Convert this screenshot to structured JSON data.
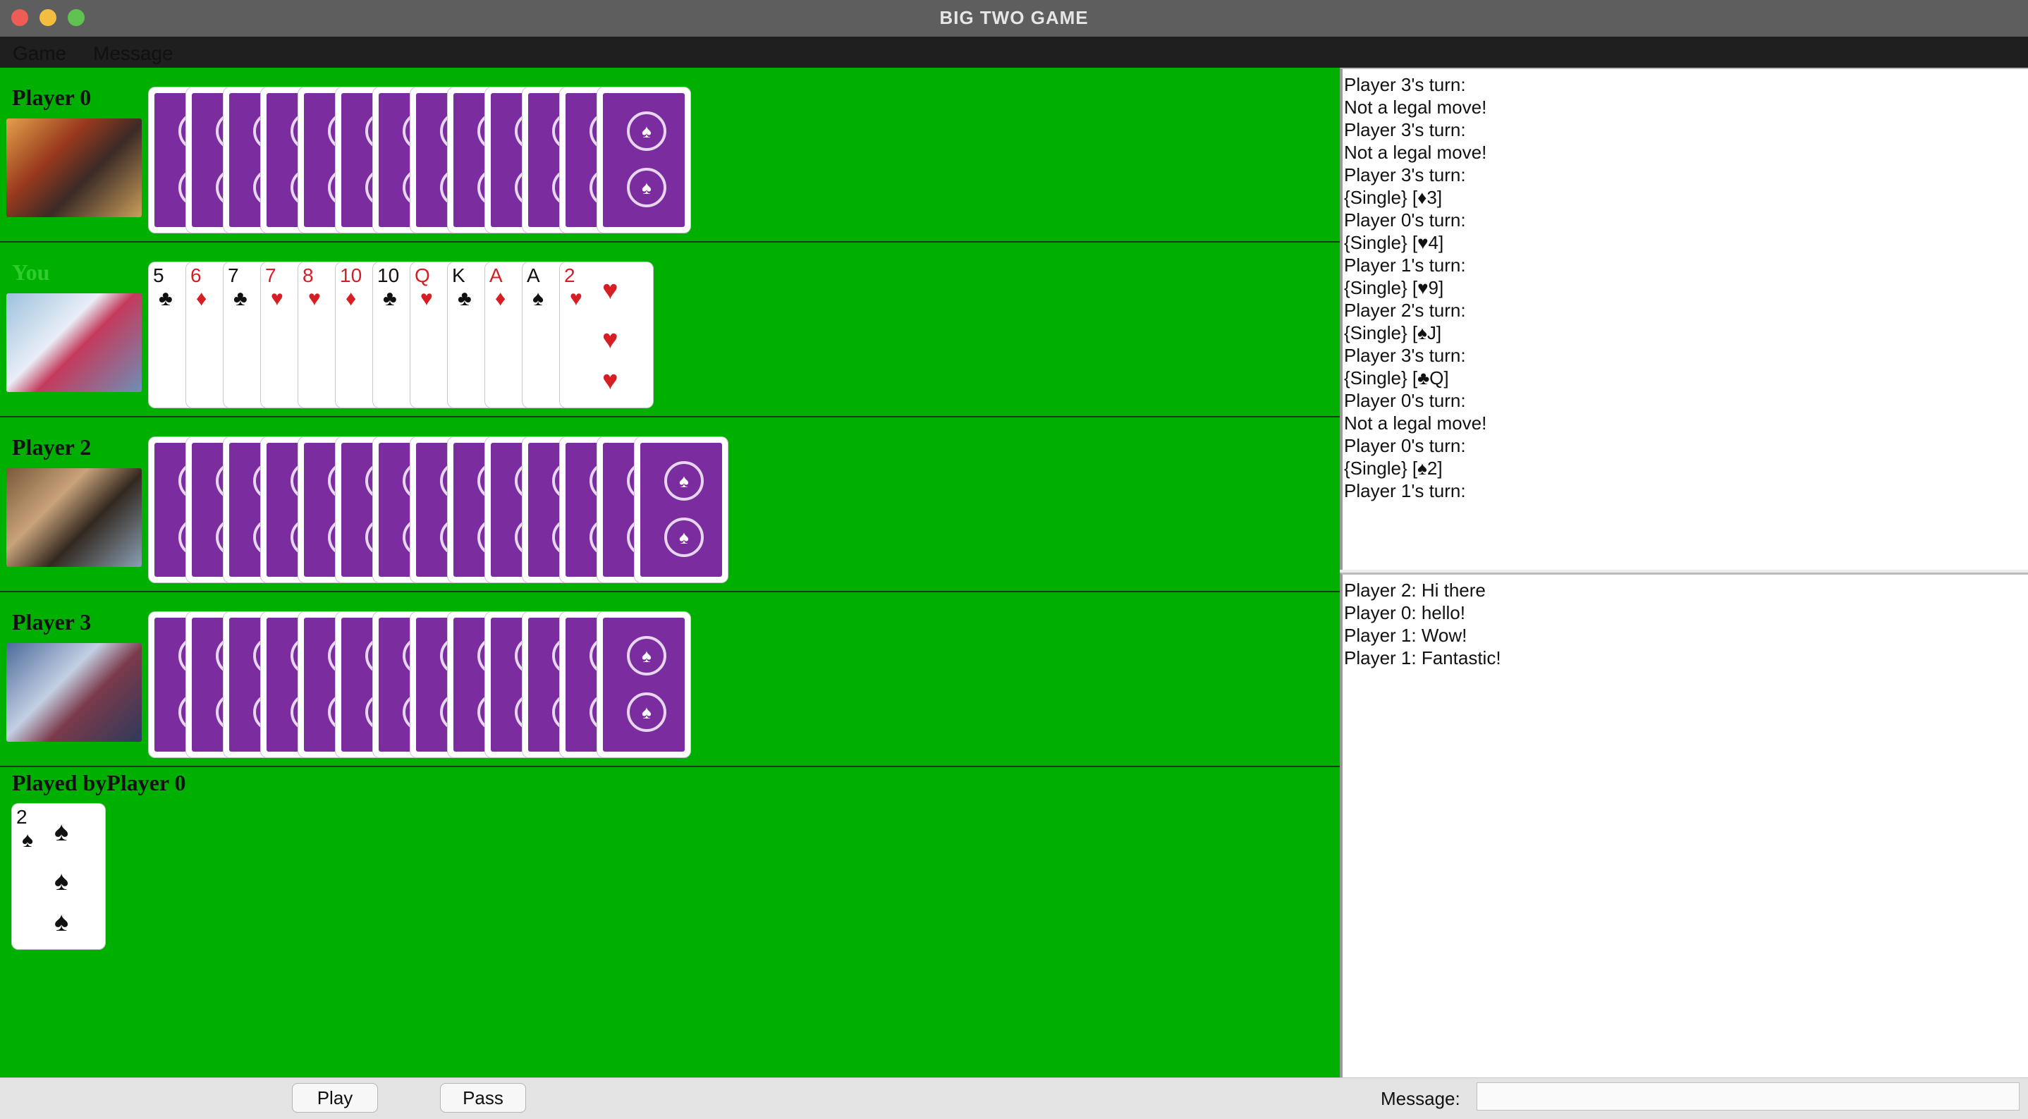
{
  "window": {
    "title": "BIG TWO GAME",
    "traffic_lights": [
      "#ee5d55",
      "#f3bd3f",
      "#5fc44f"
    ]
  },
  "menu": [
    "Game",
    "Message"
  ],
  "players": [
    {
      "name": "Player 0",
      "card_count": 13,
      "avatar": "hero-portrait-icon"
    },
    {
      "name": "You",
      "card_count": 13,
      "avatar": "hero-portrait-icon",
      "hand": [
        {
          "rank": "5",
          "suit": "♣",
          "color": "black"
        },
        {
          "rank": "6",
          "suit": "♦",
          "color": "red"
        },
        {
          "rank": "7",
          "suit": "♣",
          "color": "black"
        },
        {
          "rank": "7",
          "suit": "♥",
          "color": "red"
        },
        {
          "rank": "8",
          "suit": "♥",
          "color": "red"
        },
        {
          "rank": "10",
          "suit": "♦",
          "color": "red"
        },
        {
          "rank": "10",
          "suit": "♣",
          "color": "black"
        },
        {
          "rank": "Q",
          "suit": "♥",
          "color": "red"
        },
        {
          "rank": "K",
          "suit": "♣",
          "color": "black"
        },
        {
          "rank": "A",
          "suit": "♦",
          "color": "red"
        },
        {
          "rank": "A",
          "suit": "♠",
          "color": "black"
        },
        {
          "rank": "2",
          "suit": "♥",
          "color": "red"
        }
      ]
    },
    {
      "name": "Player 2",
      "card_count": 14,
      "avatar": "hero-portrait-icon"
    },
    {
      "name": "Player 3",
      "card_count": 13,
      "avatar": "hero-portrait-icon"
    }
  ],
  "played": {
    "label": "Played byPlayer 0",
    "card": {
      "rank": "2",
      "suit": "♠",
      "color": "black"
    }
  },
  "history": [
    "Player 3's turn:",
    "Not a legal move!",
    "Player 3's turn:",
    "Not a legal move!",
    "Player 3's turn:",
    "{Single} [♦3]",
    "Player 0's turn:",
    "{Single} [♥4]",
    "Player 1's turn:",
    "{Single} [♥9]",
    "Player 2's turn:",
    "{Single} [♠J]",
    "Player 3's turn:",
    "{Single} [♣Q]",
    "Player 0's turn:",
    "Not a legal move!",
    "Player 0's turn:",
    "{Single} [♠2]",
    "Player 1's turn:"
  ],
  "chat": [
    "Player 2: Hi there",
    "Player 0: hello!",
    "Player 1: Wow!",
    "Player 1: Fantastic!"
  ],
  "controls": {
    "play_label": "Play",
    "pass_label": "Pass",
    "message_label": "Message:",
    "message_value": ""
  },
  "colors": {
    "table": "#00b000",
    "card_back": "#7b2d9f",
    "you_label": "#2ecc2e",
    "red_suit": "#d51f24"
  }
}
